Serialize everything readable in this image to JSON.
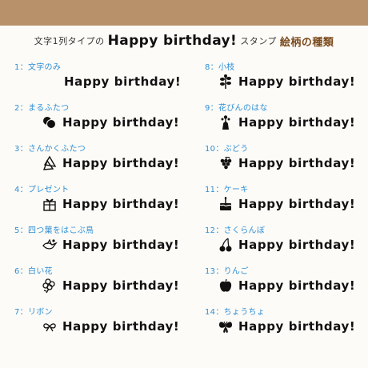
{
  "header": {
    "lead": "文字1列タイプの",
    "main": "Happy birthday!",
    "stamp": "スタンプ",
    "accent": "絵柄の種類"
  },
  "left_items": [
    {
      "label": "1：文字のみ",
      "text": "Happy birthday!",
      "icon": "none"
    },
    {
      "label": "2：まるふたつ",
      "text": "Happy birthday!",
      "icon": "two-circles-icon"
    },
    {
      "label": "3：さんかくふたつ",
      "text": "Happy birthday!",
      "icon": "two-triangles-icon"
    },
    {
      "label": "4：プレゼント",
      "text": "Happy birthday!",
      "icon": "present-icon"
    },
    {
      "label": "5：四つ葉をはこぶ鳥",
      "text": "Happy birthday!",
      "icon": "bird-icon"
    },
    {
      "label": "6：白い花",
      "text": "Happy birthday!",
      "icon": "white-flower-icon"
    },
    {
      "label": "7：リボン",
      "text": "Happy birthday!",
      "icon": "ribbon-icon"
    }
  ],
  "right_items": [
    {
      "label": "8：小枝",
      "text": "Happy birthday!",
      "icon": "twig-icon"
    },
    {
      "label": "9：花びんのはな",
      "text": "Happy birthday!",
      "icon": "vase-flower-icon"
    },
    {
      "label": "10：ぶどう",
      "text": "Happy birthday!",
      "icon": "grapes-icon"
    },
    {
      "label": "11：ケーキ",
      "text": "Happy birthday!",
      "icon": "cake-icon"
    },
    {
      "label": "12：さくらんぼ",
      "text": "Happy birthday!",
      "icon": "cherry-icon"
    },
    {
      "label": "13：りんご",
      "text": "Happy birthday!",
      "icon": "apple-icon"
    },
    {
      "label": "14：ちょうちょ",
      "text": "Happy birthday!",
      "icon": "butterfly-icon"
    }
  ],
  "colors": {
    "top_bar": "#b8916b",
    "label_blue": "#2e8fd6",
    "accent_brown": "#7a4a1c",
    "ink": "#111111"
  }
}
